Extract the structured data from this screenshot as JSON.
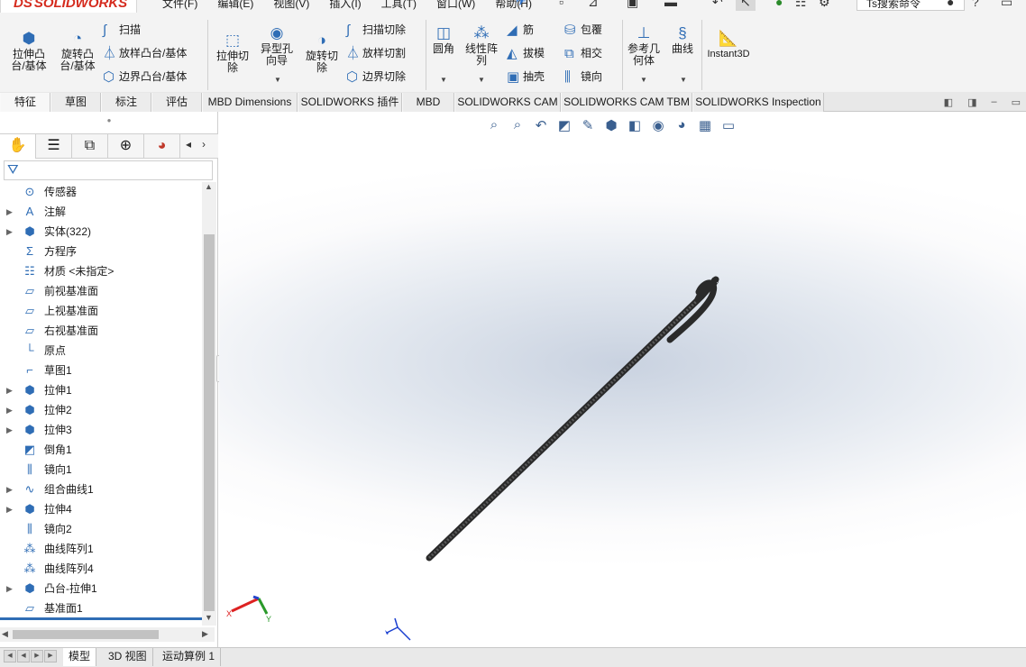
{
  "app": {
    "logo_prefix": "DS",
    "logo_text": "SOLIDWORKS"
  },
  "menu": [
    "文件(F)",
    "编辑(E)",
    "视图(V)",
    "插入(I)",
    "工具(T)",
    "窗口(W)",
    "帮助(H)"
  ],
  "search_hint": "Ts搜索命令",
  "ribbon": {
    "extrude_boss": "拉伸凸台/基体",
    "revolve_boss": "旋转凸台/基体",
    "sweep": "扫描",
    "loft_boss": "放样凸台/基体",
    "boundary_boss": "边界凸台/基体",
    "extrude_cut": "拉伸切除",
    "hole_wizard": "异型孔向导",
    "revolve_cut": "旋转切除",
    "sweep_cut": "扫描切除",
    "loft_cut": "放样切割",
    "boundary_cut": "边界切除",
    "fillet": "圆角",
    "linear_pattern": "线性阵列",
    "rib": "筋",
    "draft": "拔模",
    "shell": "抽壳",
    "wrap": "包覆",
    "intersect": "相交",
    "mirror": "镜向",
    "ref_geometry": "参考几何体",
    "curves": "曲线",
    "instant3d": "Instant3D"
  },
  "tabs": [
    "特征",
    "草图",
    "标注",
    "评估",
    "MBD Dimensions",
    "SOLIDWORKS 插件",
    "MBD",
    "SOLIDWORKS CAM",
    "SOLIDWORKS CAM TBM",
    "SOLIDWORKS Inspection"
  ],
  "active_tab": "特征",
  "tree": [
    {
      "label": "传感器",
      "icon": "sensor-icon",
      "expand": false
    },
    {
      "label": "注解",
      "icon": "annotation-icon",
      "expand": true
    },
    {
      "label": "实体(322)",
      "icon": "solid-bodies-icon",
      "expand": true
    },
    {
      "label": "方程序",
      "icon": "equation-icon",
      "expand": false
    },
    {
      "label": "材质 <未指定>",
      "icon": "material-icon",
      "expand": false
    },
    {
      "label": "前视基准面",
      "icon": "plane-icon",
      "expand": false
    },
    {
      "label": "上视基准面",
      "icon": "plane-icon",
      "expand": false
    },
    {
      "label": "右视基准面",
      "icon": "plane-icon",
      "expand": false
    },
    {
      "label": "原点",
      "icon": "origin-icon",
      "expand": false
    },
    {
      "label": "草图1",
      "icon": "sketch-icon",
      "expand": false
    },
    {
      "label": "拉伸1",
      "icon": "extrude-icon",
      "expand": true
    },
    {
      "label": "拉伸2",
      "icon": "extrude-icon",
      "expand": true
    },
    {
      "label": "拉伸3",
      "icon": "extrude-icon",
      "expand": true
    },
    {
      "label": "倒角1",
      "icon": "chamfer-icon",
      "expand": false
    },
    {
      "label": "镜向1",
      "icon": "mirror-icon",
      "expand": false
    },
    {
      "label": "组合曲线1",
      "icon": "composite-curve-icon",
      "expand": true
    },
    {
      "label": "拉伸4",
      "icon": "extrude-icon",
      "expand": true
    },
    {
      "label": "镜向2",
      "icon": "mirror-icon",
      "expand": false
    },
    {
      "label": "曲线阵列1",
      "icon": "curve-pattern-icon",
      "expand": false
    },
    {
      "label": "曲线阵列4",
      "icon": "curve-pattern-icon",
      "expand": false
    },
    {
      "label": "凸台-拉伸1",
      "icon": "extrude-icon",
      "expand": true
    },
    {
      "label": "基准面1",
      "icon": "plane-icon",
      "expand": false
    }
  ],
  "bottom_tabs": [
    "模型",
    "3D 视图",
    "运动算例 1"
  ],
  "triad_labels": {
    "x": "X",
    "y": "Y"
  },
  "colors": {
    "accent": "#2f6db5",
    "logo": "#d52b1e"
  }
}
